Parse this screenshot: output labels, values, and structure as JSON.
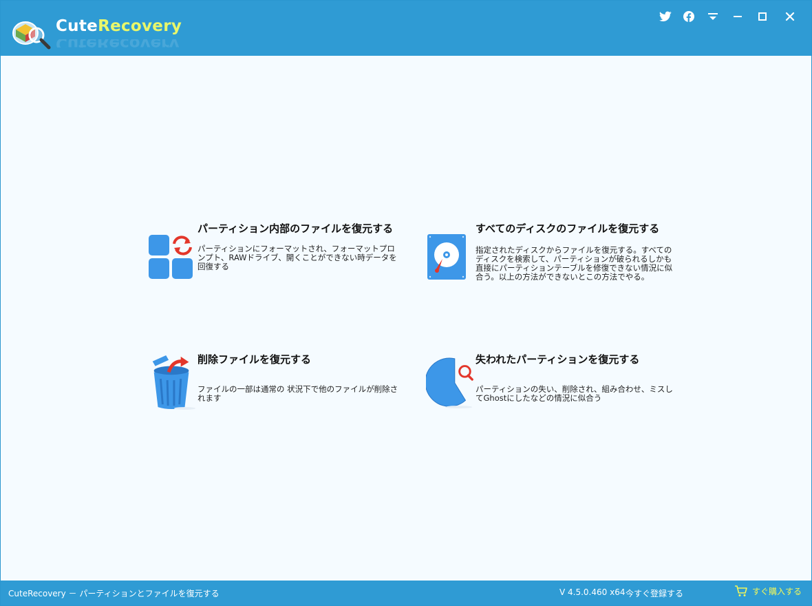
{
  "app": {
    "brand_part1": "Cute",
    "brand_part2": "Recovery"
  },
  "titlebar": {
    "buttons": [
      {
        "icon": "twitter-icon"
      },
      {
        "icon": "facebook-icon"
      },
      {
        "icon": "dropdown-menu-icon"
      },
      {
        "icon": "minimize-icon"
      },
      {
        "icon": "maximize-icon"
      },
      {
        "icon": "close-icon"
      }
    ]
  },
  "options": [
    {
      "title": "パーティション内部のファイルを復元する",
      "description": "パーティションにフォーマットされ、フォーマットプロンプト、RAWドライブ、開くことができない時データを回復する",
      "icon": "partition-restore-icon"
    },
    {
      "title": "すべてのディスクのファイルを復元する",
      "description": "指定されたディスクからファイルを復元する。すべてのディスクを検索して、パーティションが破られるしかも直接にパーティションテーブルを修復できない情況に似合う。以上の方法ができないとこの方法でやる。",
      "icon": "hard-disk-icon"
    },
    {
      "title": "削除ファイルを復元する",
      "description": "ファイルの一部は通常の 状況下で他のファイルが削除されます",
      "icon": "trash-restore-icon"
    },
    {
      "title": "失われたパーティションを復元する",
      "description": "パーティションの失い、削除され、組み合わせ、ミスしてGhostにしたなどの情況に似合う",
      "icon": "pie-search-icon"
    }
  ],
  "statusbar": {
    "left_text": "CuteRecovery － パーティションとファイルを復元する",
    "version": "V 4.5.0.460 x64",
    "register": "今すぐ登録する",
    "buy": "すぐ購入する"
  },
  "colors": {
    "titlebar": "#2f9bd4",
    "background": "#f5fbff",
    "brand_accent": "#e9f76a",
    "buy_text": "#f2f75a",
    "icon_blue": "#3d97e8",
    "icon_red": "#e3362a"
  }
}
